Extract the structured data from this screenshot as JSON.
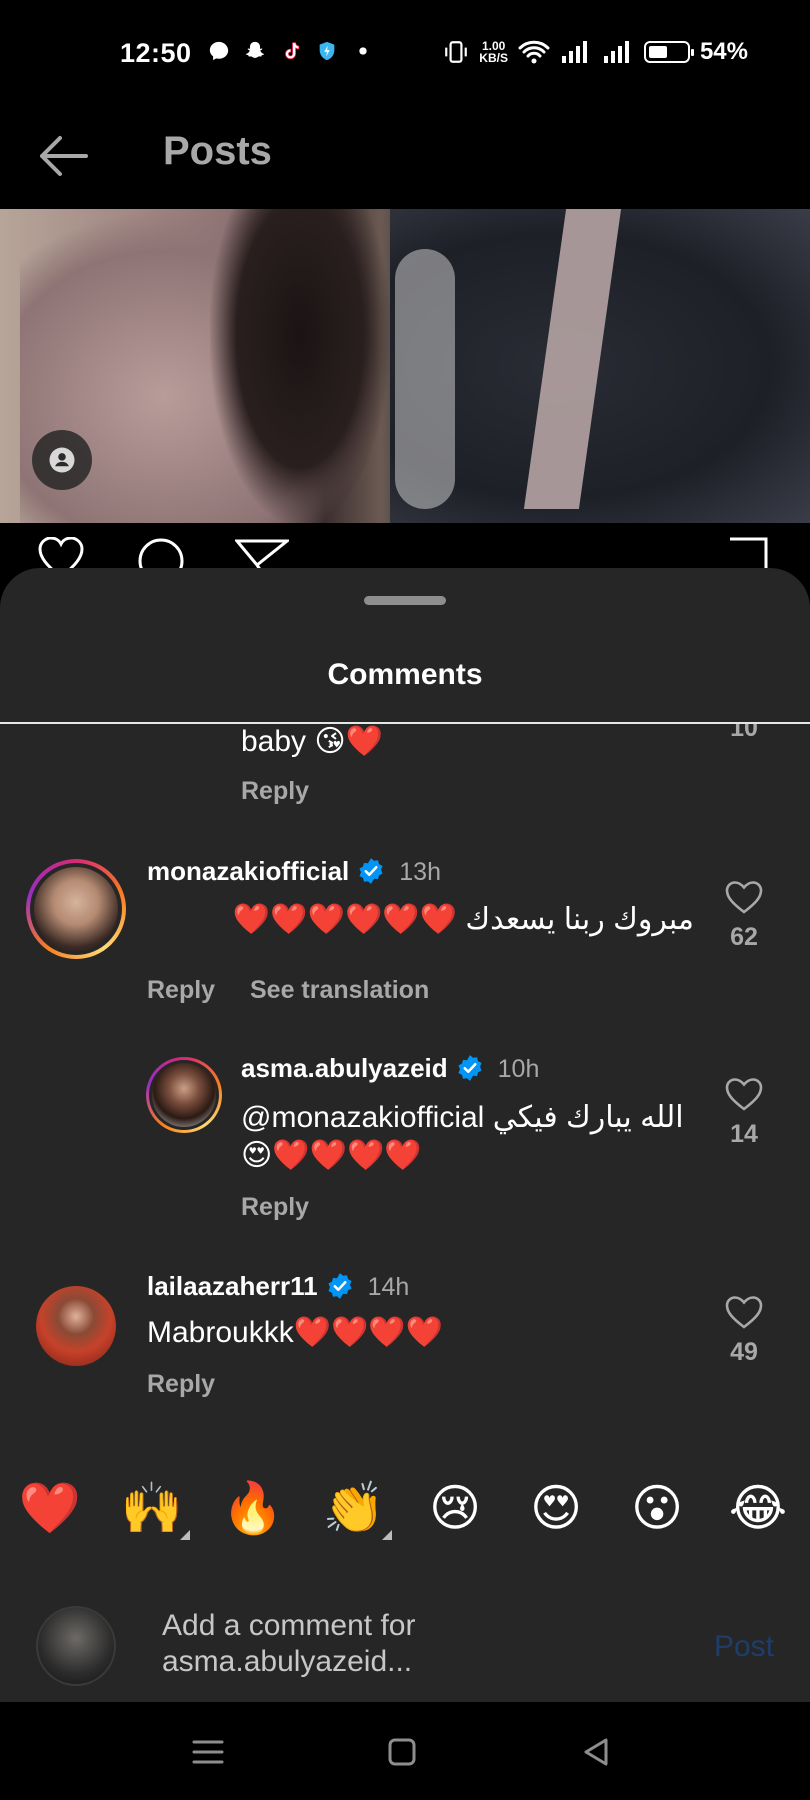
{
  "status_bar": {
    "time": "12:50",
    "speed_value": "1.00",
    "speed_unit": "KB/S",
    "battery": "54%",
    "battery_level": 0.54,
    "icons": [
      "messenger-icon",
      "snapchat-icon",
      "tiktok-icon",
      "shield-icon",
      "dot-icon",
      "vibrate-icon",
      "wifi-icon",
      "signal-icon",
      "signal-icon",
      "battery-icon"
    ]
  },
  "header": {
    "title": "Posts"
  },
  "sheet": {
    "title": "Comments"
  },
  "comments": {
    "partial": {
      "text": "baby 😘❤️",
      "reply": "Reply",
      "likes": "10"
    },
    "c1": {
      "username": "monazakiofficial",
      "time": "13h",
      "text": "مبروك ربنا يسعدك ❤️❤️❤️❤️❤️❤️",
      "reply": "Reply",
      "translate": "See translation",
      "likes": "62"
    },
    "c2": {
      "username": "asma.abulyazeid",
      "time": "10h",
      "line1": "@monazakiofficial الله يبارك فيكي",
      "line2": "😍❤️❤️❤️❤️",
      "reply": "Reply",
      "likes": "14"
    },
    "c3": {
      "username": "lailaazaherr11",
      "time": "14h",
      "text": "Mabroukkk❤️❤️❤️❤️",
      "reply": "Reply",
      "likes": "49"
    }
  },
  "emoji_bar": [
    "❤️",
    "🙌",
    "🔥",
    "👏",
    "😢",
    "😍",
    "😮",
    "😂"
  ],
  "composer": {
    "placeholder_line1": "Add a comment for",
    "placeholder_line2": "asma.abulyazeid...",
    "post_label": "Post"
  },
  "colors": {
    "sheet_bg": "#262626",
    "verified": "#0095f6",
    "muted": "#a8a8a8",
    "post_disabled": "#1f3d6b"
  }
}
